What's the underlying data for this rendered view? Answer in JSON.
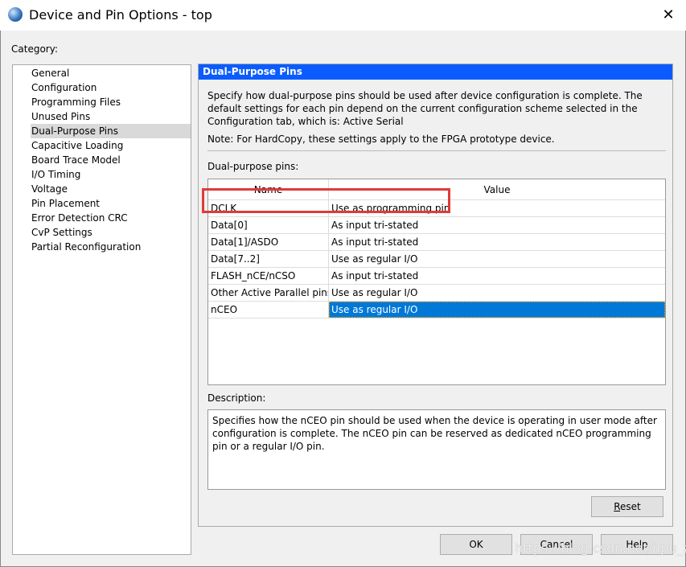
{
  "window": {
    "title": "Device and Pin Options - top",
    "close_icon": "close-icon",
    "app_icon": "quartus-globe-icon"
  },
  "category": {
    "label": "Category:",
    "items": [
      "General",
      "Configuration",
      "Programming Files",
      "Unused Pins",
      "Dual-Purpose Pins",
      "Capacitive Loading",
      "Board Trace Model",
      "I/O Timing",
      "Voltage",
      "Pin Placement",
      "Error Detection CRC",
      "CvP Settings",
      "Partial Reconfiguration"
    ],
    "selected": "Dual-Purpose Pins"
  },
  "panel": {
    "header": "Dual-Purpose Pins",
    "header_color": "#0a5cff",
    "intro": "Specify how dual-purpose pins should be used after device configuration is complete. The default settings for each pin depend on the current configuration scheme selected in the Configuration tab, which is:  Active Serial",
    "note": "Note: For HardCopy, these settings apply to the FPGA prototype device.",
    "pins_label": "Dual-purpose pins:",
    "table": {
      "columns": [
        "Name",
        "Value"
      ],
      "rows": [
        {
          "name": "DCLK",
          "value": "Use as programming pin"
        },
        {
          "name": "Data[0]",
          "value": "As input tri-stated"
        },
        {
          "name": "Data[1]/ASDO",
          "value": "As input tri-stated"
        },
        {
          "name": "Data[7..2]",
          "value": "Use as regular I/O"
        },
        {
          "name": "FLASH_nCE/nCSO",
          "value": "As input tri-stated"
        },
        {
          "name": "Other Active Parallel pins",
          "value": "Use as regular I/O"
        },
        {
          "name": "nCEO",
          "value": "Use as regular I/O"
        }
      ],
      "selected_row": "nCEO",
      "highlight_color": "#e03a3a"
    },
    "description_label": "Description:",
    "description": "Specifies how the nCEO pin should be used when the device is operating in user mode after configuration is complete. The nCEO pin can be reserved as dedicated nCEO programming pin or a regular I/O pin.",
    "reset": "Reset"
  },
  "buttons": {
    "ok": "OK",
    "cancel": "Cancel",
    "help": "Help"
  },
  "watermark": "https://blog.csdn.net/hpu_zhn"
}
